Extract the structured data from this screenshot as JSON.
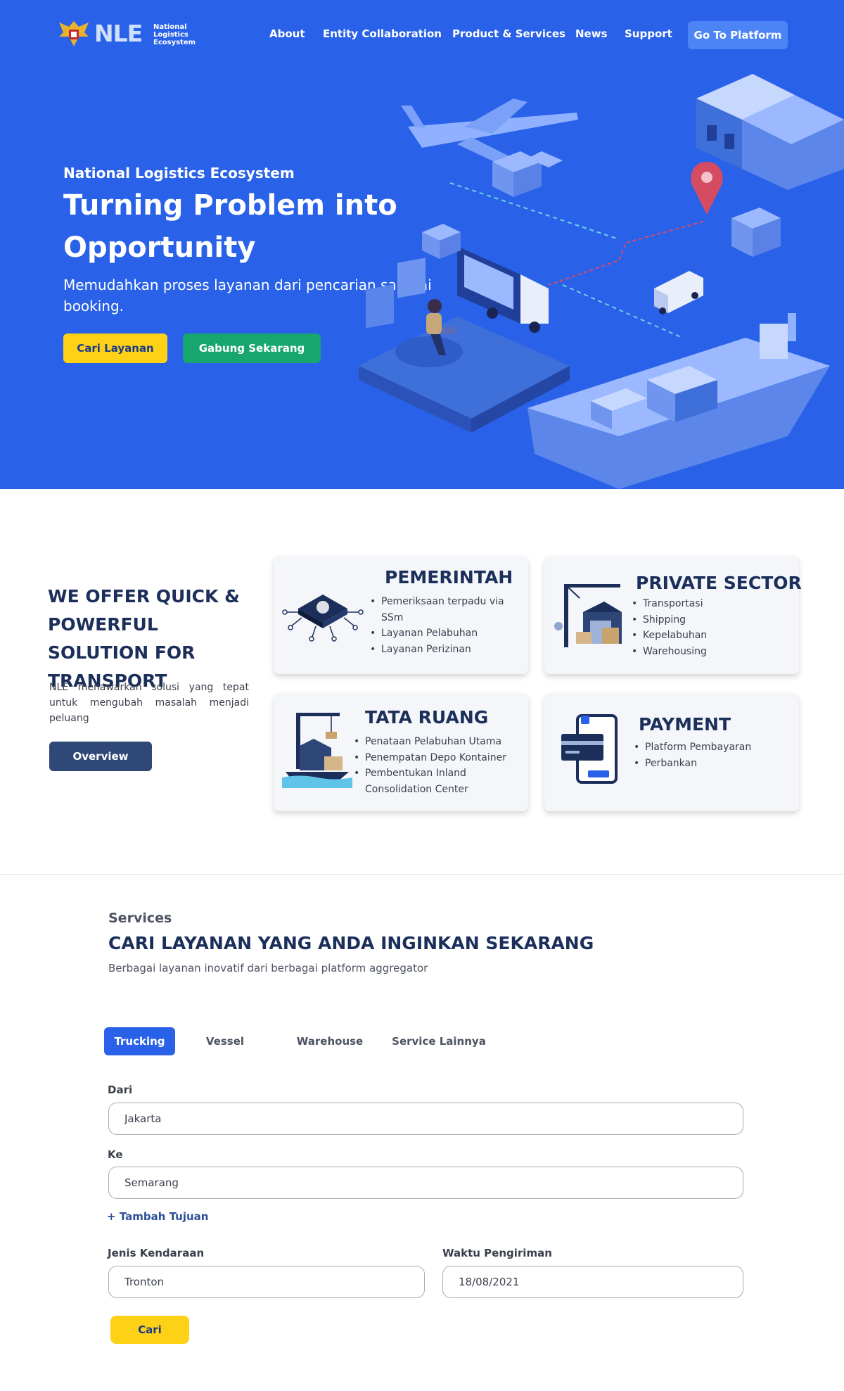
{
  "nav": {
    "logo_text": "NLE",
    "logo_sub": [
      "National",
      "Logistics",
      "Ecosystem"
    ],
    "links": [
      "About",
      "Entity Collaboration",
      "Product & Services",
      "News",
      "Support"
    ],
    "cta": "Go To Platform"
  },
  "hero": {
    "eyebrow": "National Logistics Ecosystem",
    "title": "Turning Problem into Opportunity",
    "description": "Memudahkan proses layanan dari  pencarian sampai booking.",
    "primary_button": "Cari Layanan",
    "secondary_button": "Gabung Sekarang"
  },
  "offer": {
    "title": "WE OFFER QUICK & POWERFUL SOLUTION FOR TRANSPORT",
    "description": "NLE menawarkan solusi yang tepat untuk mengubah masalah menjadi peluang",
    "button": "Overview",
    "cards": [
      {
        "title": "PEMERINTAH",
        "items": [
          "Pemeriksaan terpadu via SSm",
          "Layanan Pelabuhan",
          "Layanan Perizinan"
        ]
      },
      {
        "title": "PRIVATE SECTOR",
        "items": [
          "Transportasi",
          "Shipping",
          "Kepelabuhan",
          "Warehousing"
        ]
      },
      {
        "title": "TATA RUANG",
        "items": [
          "Penataan Pelabuhan Utama",
          "Penempatan Depo Kontainer",
          "Pembentukan Inland Consolidation Center"
        ]
      },
      {
        "title": "PAYMENT",
        "items": [
          "Platform Pembayaran",
          "Perbankan"
        ]
      }
    ]
  },
  "services": {
    "eyebrow": "Services",
    "title": "CARI LAYANAN YANG ANDA INGINKAN SEKARANG",
    "subtitle": "Berbagai layanan inovatif dari berbagai platform aggregator",
    "tabs": [
      "Trucking",
      "Vessel",
      "Warehouse",
      "Service Lainnya"
    ],
    "active_tab": "Trucking",
    "form": {
      "from_label": "Dari",
      "from_value": "Jakarta",
      "to_label": "Ke",
      "to_value": "Semarang",
      "add_destination": "+ Tambah Tujuan",
      "vehicle_label": "Jenis Kendaraan",
      "vehicle_value": "Tronton",
      "time_label": "Waktu Pengiriman",
      "time_value": "18/08/2021",
      "submit": "Cari"
    }
  },
  "colors": {
    "hero_bg": "#2962e8",
    "accent_yellow": "#fcd116",
    "accent_green": "#16a66e",
    "navy": "#1b2f5a",
    "overview_btn": "#2f4877"
  },
  "icons": [
    "emblem-icon",
    "airplane-icon",
    "warehouse-icon",
    "location-pin-icon",
    "truck-icon",
    "van-icon",
    "ship-icon",
    "chip-icon",
    "crane-warehouse-icon",
    "port-crane-icon",
    "payment-phone-icon"
  ]
}
